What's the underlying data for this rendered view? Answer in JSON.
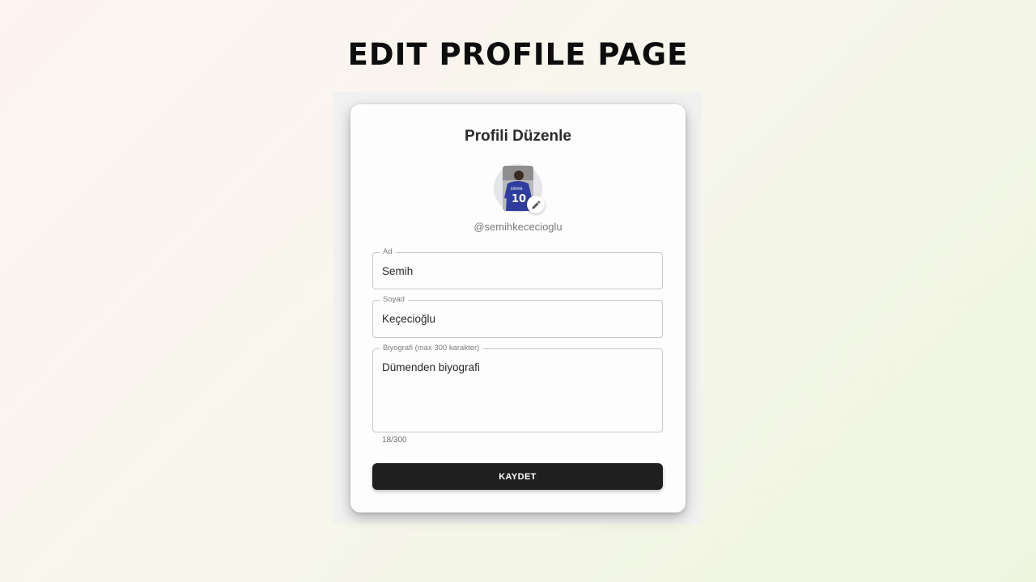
{
  "page": {
    "heading": "EDIT PROFILE PAGE"
  },
  "card": {
    "title": "Profili Düzenle",
    "username": "@semihkececioglu",
    "avatar_jersey_number": "10",
    "edit_icon": "pencil-icon"
  },
  "form": {
    "first_name": {
      "label": "Ad",
      "value": "Semih"
    },
    "last_name": {
      "label": "Soyad",
      "value": "Keçecioğlu"
    },
    "bio": {
      "label": "Biyografi (max 300 karakter)",
      "value": "Dümenden biyografi",
      "counter": "18/300"
    },
    "save_label": "KAYDET"
  },
  "colors": {
    "button_bg": "#1f1f1f",
    "jersey": "#2f3e9e"
  }
}
